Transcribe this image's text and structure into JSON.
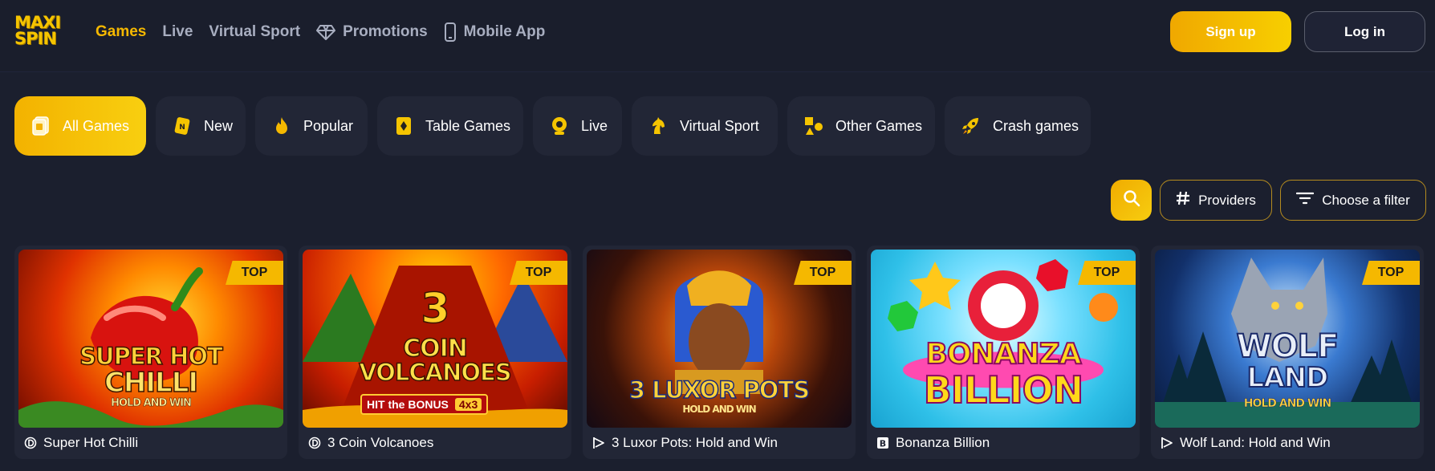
{
  "logo": {
    "line1": "MAXI",
    "line2": "SPIN"
  },
  "nav": {
    "items": [
      {
        "label": "Games",
        "icon": ""
      },
      {
        "label": "Live",
        "icon": ""
      },
      {
        "label": "Virtual Sport",
        "icon": ""
      },
      {
        "label": "Promotions",
        "icon": "diamond-icon"
      },
      {
        "label": "Mobile App",
        "icon": "phone-icon"
      }
    ],
    "active": "Games"
  },
  "auth": {
    "signup_label": "Sign up",
    "login_label": "Log in"
  },
  "categories": [
    {
      "label": "All Games",
      "icon": "cards-icon",
      "active": true
    },
    {
      "label": "New",
      "icon": "new-badge-icon"
    },
    {
      "label": "Popular",
      "icon": "flame-icon"
    },
    {
      "label": "Table Games",
      "icon": "diamond-card-icon"
    },
    {
      "label": "Live",
      "icon": "webcam-icon"
    },
    {
      "label": "Virtual Sport",
      "icon": "horse-icon"
    },
    {
      "label": "Other Games",
      "icon": "shapes-icon"
    },
    {
      "label": "Crash games",
      "icon": "rocket-icon"
    }
  ],
  "filters": {
    "providers_label": "Providers",
    "filter_label": "Choose a filter"
  },
  "games": [
    {
      "name": "Super Hot Chilli",
      "badge": "TOP",
      "provider_icon": "provider-d-icon",
      "art_lines": [
        "SUPER HOT",
        "CHILLI"
      ],
      "art_sub": "HOLD AND WIN"
    },
    {
      "name": "3 Coin Volcanoes",
      "badge": "TOP",
      "provider_icon": "provider-d-icon",
      "art_lines": [
        "3",
        "COIN",
        "VOLCANOES"
      ],
      "art_sub": "HIT the BONUS",
      "art_sub2": "4x3"
    },
    {
      "name": "3 Luxor Pots: Hold and Win",
      "badge": "TOP",
      "provider_icon": "provider-play-icon",
      "art_lines": [
        "3 LUXOR POTS"
      ],
      "art_sub": "HOLD AND WIN"
    },
    {
      "name": "Bonanza Billion",
      "badge": "TOP",
      "provider_icon": "provider-b-icon",
      "art_lines": [
        "BONANZA",
        "BILLION"
      ]
    },
    {
      "name": "Wolf Land: Hold and Win",
      "badge": "TOP",
      "provider_icon": "provider-play-icon",
      "art_lines": [
        "WOLF",
        "LAND"
      ],
      "art_sub": "HOLD AND WIN"
    }
  ],
  "colors": {
    "accent": "#f5b800",
    "background": "#1b1f2e",
    "card": "#222636"
  }
}
